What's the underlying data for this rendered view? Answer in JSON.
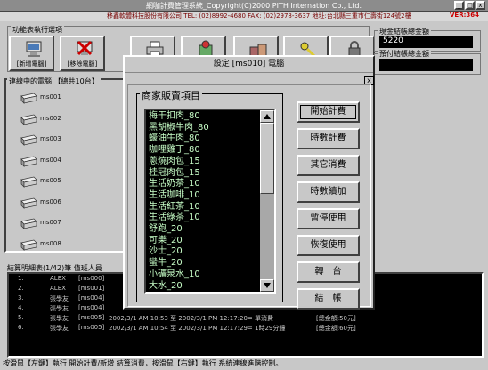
{
  "window": {
    "title": "網咖計費管理系統_Copyright(C)2000 PITH Internation Co., Ltd.",
    "company": "移鑫軟體科技股份有限公司  TEL: (02)8992-4680  FAX: (02)2978-3637 地址:台北縣三重市仁壽街124號2樓",
    "version": "VER:364",
    "min_glyph": "_",
    "max_glyph": "□",
    "close_glyph": "x"
  },
  "functions": {
    "group_label": "功能表執行選項",
    "tools": [
      {
        "label": "[新增電腦]",
        "icon": "computer-icon"
      },
      {
        "label": "[移除電腦]",
        "icon": "remove-computer-icon"
      },
      {
        "label": "",
        "icon": "printer-icon"
      },
      {
        "label": "",
        "icon": "settings-icon"
      },
      {
        "label": "",
        "icon": "boxes-icon"
      },
      {
        "label": "",
        "icon": "key-icon"
      },
      {
        "label": "",
        "icon": "lock-icon"
      }
    ]
  },
  "cash": {
    "label": "現金結帳總金額",
    "value": "5220"
  },
  "prepaid": {
    "label": "預付結帳總金額",
    "value": ""
  },
  "computers": {
    "label": "連線中的電腦 【總共10台】",
    "items": [
      "ms001",
      "ms002",
      "ms003",
      "ms004",
      "ms005",
      "ms006",
      "ms007",
      "ms008"
    ]
  },
  "settlement": {
    "label": "結算明細表(1/42)筆 值班人員",
    "rows": [
      {
        "no": "1.",
        "who": "ALEX",
        "pc": "[ms000]",
        "time": "",
        "note": ""
      },
      {
        "no": "2.",
        "who": "ALEX",
        "pc": "[ms001]",
        "time": "",
        "note": ""
      },
      {
        "no": "3.",
        "who": "張學友",
        "pc": "[ms004]",
        "time": "",
        "note": ""
      },
      {
        "no": "4.",
        "who": "張學友",
        "pc": "[ms004]",
        "time": "",
        "note": ""
      },
      {
        "no": "5.",
        "who": "張學友",
        "pc": "[ms005]",
        "time": "2002/3/1 AM 10:53 至 2002/3/1 PM 12:17:20= 單消費",
        "note": "[總金額:50元]"
      },
      {
        "no": "6.",
        "who": "張學友",
        "pc": "[ms005]",
        "time": "2002/3/1 AM 10:54 至 2002/3/1 PM 12:17:29= 1時29分鐘",
        "note": "[總金額:60元]"
      }
    ]
  },
  "status": "按滑鼠【左鍵】執行 開始計費/新增 結算消費，按滑鼠【右鍵】執行 系統連線進階控制。",
  "dialog": {
    "title": "設定 [ms010] 電腦",
    "close_glyph": "x",
    "group_label": "商家販賣項目",
    "products": [
      "梅干扣肉_80",
      "黑胡椒牛肉_80",
      "蠔油牛肉_80",
      "咖哩雞丁_80",
      "蔥燒肉包_15",
      "桂冠肉包_15",
      "生活奶茶_10",
      "生活咖啡_10",
      "生活紅茶_10",
      "生活綠茶_10",
      "舒跑_20",
      "可樂_20",
      "沙士_20",
      "蠻牛_20",
      "小礦泉水_10",
      "大水_20"
    ],
    "actions": [
      "開始計費",
      "時數計費",
      "其它消費",
      "時數續加",
      "暫停使用",
      "恢復使用",
      "轉　台",
      "結　帳"
    ]
  },
  "colors": {
    "list_text": "#c8ffc8",
    "cash_bg": "#000000"
  }
}
